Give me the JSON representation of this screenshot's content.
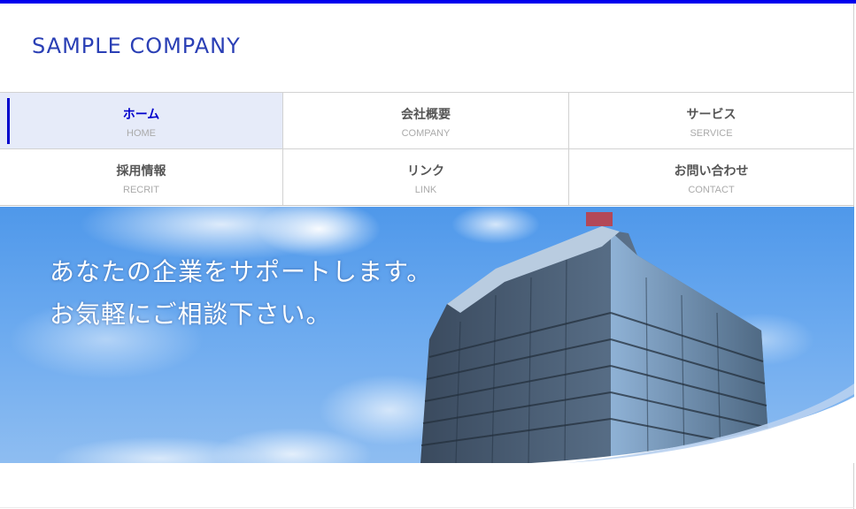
{
  "site": {
    "logo": "SAMPLE COMPANY"
  },
  "nav": {
    "items": [
      {
        "ja": "ホーム",
        "en": "HOME"
      },
      {
        "ja": "会社概要",
        "en": "COMPANY"
      },
      {
        "ja": "サービス",
        "en": "SERVICE"
      },
      {
        "ja": "採用情報",
        "en": "RECRIT"
      },
      {
        "ja": "リンク",
        "en": "LINK"
      },
      {
        "ja": "お問い合わせ",
        "en": "CONTACT"
      }
    ],
    "active_index": 0
  },
  "hero": {
    "line1": "あなたの企業をサポートします。",
    "line2": "お気軽にご相談下さい。"
  },
  "colors": {
    "accent": "#0000ee",
    "logo": "#2a3fb5",
    "active_bg": "#e6ebf9",
    "sky": "#6aa9ef"
  }
}
